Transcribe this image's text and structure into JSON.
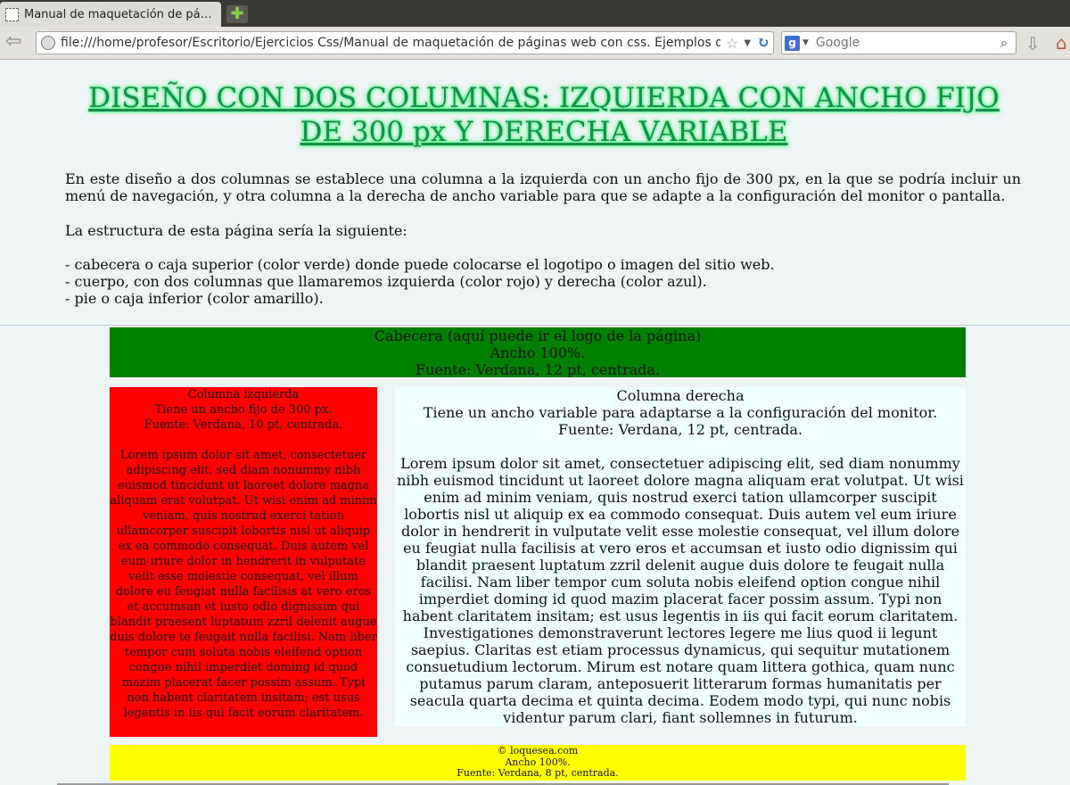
{
  "browser": {
    "tab_title": "Manual de maquetación de pá…",
    "newtab_label": "✚",
    "url": "file:///home/profesor/Escritorio/Ejercicios Css/Manual de maquetación de páginas web con css. Ejemplos de m",
    "search_placeholder": "Google"
  },
  "page": {
    "title": "DISEÑO CON DOS COLUMNAS: IZQUIERDA CON ANCHO FIJO DE 300 px Y DERECHA VARIABLE",
    "intro": "En este diseño a dos columnas se establece una columna a la izquierda con un ancho fijo de 300 px, en la que se podría incluir un menú de navegación, y otra columna a la derecha de ancho variable para que se adapte a la configuración del monitor o pantalla.",
    "structure_intro": "La estructura de esta página sería la siguiente:",
    "list": [
      "- cabecera o caja superior (color verde) donde puede colocarse el logotipo o imagen del sitio web.",
      "- cuerpo, con dos columnas que llamaremos izquierda (color rojo) y derecha (color azul).",
      "- pie o caja inferior (color amarillo)."
    ],
    "header_box": [
      "Cabecera (aquí puede ir el logo de la página)",
      "Ancho 100%.",
      "Fuente: Verdana, 12 pt, centrada."
    ],
    "left_col": {
      "lines": [
        "Columna izquierda",
        "Tiene un ancho fijo de 300 px.",
        "Fuente: Verdana, 10 pt, centrada."
      ],
      "text": "Lorem ipsum dolor sit amet, consectetuer adipiscing elit, sed diam nonummy nibh euismod tincidunt ut laoreet dolore magna aliquam erat volutpat. Ut wisi enim ad minim veniam, quis nostrud exerci tation ullamcorper suscipit lobortis nisl ut aliquip ex ea commodo consequat. Duis autem vel eum iriure dolor in hendrerit in vulputate velit esse molestie consequat, vel illum dolore eu feugiat nulla facilisis at vero eros et accumsan et iusto odio dignissim qui blandit praesent luptatum zzril delenit augue duis dolore te feugait nulla facilisi. Nam liber tempor cum soluta nobis eleifend option congue nihil imperdiet doming id quod mazim placerat facer possim assum. Typi non habent claritatem insitam; est usus legentis in iis qui facit eorum claritatem."
    },
    "right_col": {
      "lines": [
        "Columna derecha",
        "Tiene un ancho variable para adaptarse a la configuración del monitor.",
        "Fuente: Verdana, 12 pt, centrada."
      ],
      "text": "Lorem ipsum dolor sit amet, consectetuer adipiscing elit, sed diam nonummy nibh euismod tincidunt ut laoreet dolore magna aliquam erat volutpat. Ut wisi enim ad minim veniam, quis nostrud exerci tation ullamcorper suscipit lobortis nisl ut aliquip ex ea commodo consequat. Duis autem vel eum iriure dolor in hendrerit in vulputate velit esse molestie consequat, vel illum dolore eu feugiat nulla facilisis at vero eros et accumsan et iusto odio dignissim qui blandit praesent luptatum zzril delenit augue duis dolore te feugait nulla facilisi. Nam liber tempor cum soluta nobis eleifend option congue nihil imperdiet doming id quod mazim placerat facer possim assum. Typi non habent claritatem insitam; est usus legentis in iis qui facit eorum claritatem. Investigationes demonstraverunt lectores legere me lius quod ii legunt saepius. Claritas est etiam processus dynamicus, qui sequitur mutationem consuetudium lectorum. Mirum est notare quam littera gothica, quam nunc putamus parum claram, anteposuerit litterarum formas humanitatis per seacula quarta decima et quinta decima. Eodem modo typi, qui nunc nobis videntur parum clari, fiant sollemnes in futurum."
    },
    "footer_box": [
      "© loquesea.com",
      "Ancho 100%.",
      "Fuente: Verdana, 8 pt, centrada."
    ]
  },
  "colors": {
    "header": "#008000",
    "left": "#ff0000",
    "right": "#f0ffff",
    "footer": "#ffff00",
    "title": "#1e8a4f"
  }
}
